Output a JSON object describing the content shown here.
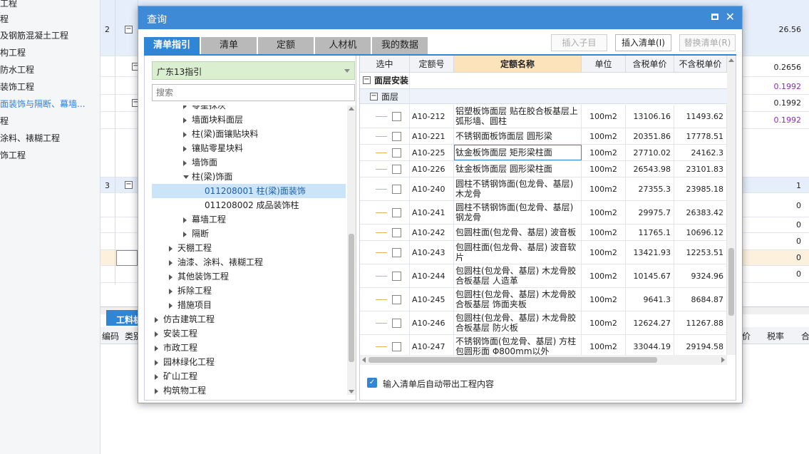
{
  "background": {
    "left_items": [
      {
        "label": "工程",
        "selected": false
      },
      {
        "label": "程",
        "selected": false
      },
      {
        "label": "及钢筋混凝土工程",
        "selected": false
      },
      {
        "label": "构工程",
        "selected": false
      },
      {
        "label": "防水工程",
        "selected": false
      },
      {
        "label": "装饰工程",
        "selected": false
      },
      {
        "label": "面装饰与隔断、幕墙...",
        "selected": true
      },
      {
        "label": "程",
        "selected": false
      },
      {
        "label": "涂料、裱糊工程",
        "selected": false
      },
      {
        "label": "饰工程",
        "selected": false
      }
    ],
    "row_index_2": "2",
    "row_index_3": "3",
    "values": [
      "26.56",
      "0.2656",
      "0.1992",
      "0.1992",
      "0.1992",
      "1",
      "0",
      "0",
      "0",
      "0",
      "0"
    ],
    "bottom_tab": "工料机",
    "bottom_headers": {
      "code": "编码",
      "type": "类别",
      "price": "价",
      "tax": "税率",
      "total": "合"
    }
  },
  "dialog": {
    "title": "查询",
    "tabs": [
      "清单指引",
      "清单",
      "定额",
      "人材机",
      "我的数据"
    ],
    "buttons": {
      "insert_child": "插入子目",
      "insert_list": "插入清单(I)",
      "replace_list": "替换清单(R)"
    },
    "dropdown_value": "广东13指引",
    "search_placeholder": "搜索",
    "tree": [
      {
        "label": "零星抹灰",
        "level": 2,
        "arrow": "right"
      },
      {
        "label": "墙面块料面层",
        "level": 2,
        "arrow": "right"
      },
      {
        "label": "柱(梁)面镶贴块料",
        "level": 2,
        "arrow": "right"
      },
      {
        "label": "镶贴零星块料",
        "level": 2,
        "arrow": "right"
      },
      {
        "label": "墙饰面",
        "level": 2,
        "arrow": "right"
      },
      {
        "label": "柱(梁)饰面",
        "level": 2,
        "arrow": "down"
      },
      {
        "label": "011208001  柱(梁)面装饰",
        "level": 3,
        "arrow": "",
        "selected": true
      },
      {
        "label": "011208002  成品装饰柱",
        "level": 3,
        "arrow": ""
      },
      {
        "label": "幕墙工程",
        "level": 2,
        "arrow": "right"
      },
      {
        "label": "隔断",
        "level": 2,
        "arrow": "right"
      },
      {
        "label": "天棚工程",
        "level": 1,
        "arrow": "right"
      },
      {
        "label": "油漆、涂料、裱糊工程",
        "level": 1,
        "arrow": "right"
      },
      {
        "label": "其他装饰工程",
        "level": 1,
        "arrow": "right"
      },
      {
        "label": "拆除工程",
        "level": 1,
        "arrow": "right"
      },
      {
        "label": "措施项目",
        "level": 1,
        "arrow": "right"
      },
      {
        "label": "仿古建筑工程",
        "level": 0,
        "arrow": "right"
      },
      {
        "label": "安装工程",
        "level": 0,
        "arrow": "right"
      },
      {
        "label": "市政工程",
        "level": 0,
        "arrow": "right"
      },
      {
        "label": "园林绿化工程",
        "level": 0,
        "arrow": "right"
      },
      {
        "label": "矿山工程",
        "level": 0,
        "arrow": "right"
      },
      {
        "label": "构筑物工程",
        "level": 0,
        "arrow": "right"
      }
    ],
    "grid": {
      "headers": [
        "选中",
        "定额号",
        "定额名称",
        "单位",
        "含税单价",
        "不含税单价"
      ],
      "group1": "面层安装",
      "group2": "面层",
      "rows": [
        {
          "code": "A10-212",
          "name": "铝塑板饰面层 贴在胶合板基层上 弧形墙、圆柱",
          "unit": "100m2",
          "tax": "13106.16",
          "notax": "11493.62"
        },
        {
          "code": "A10-221",
          "name": "不锈钢面板饰面层 圆形梁",
          "unit": "100m2",
          "tax": "20351.86",
          "notax": "17778.51"
        },
        {
          "code": "A10-225",
          "name": "钛金板饰面层 矩形梁柱面",
          "unit": "100m2",
          "tax": "27710.02",
          "notax": "24162.3",
          "focus": true
        },
        {
          "code": "A10-226",
          "name": "钛金板饰面层 圆形梁柱面",
          "unit": "100m2",
          "tax": "26543.98",
          "notax": "23101.83"
        },
        {
          "code": "A10-240",
          "name": "圆柱不锈钢饰面(包龙骨、基层) 木龙骨",
          "unit": "100m2",
          "tax": "27355.3",
          "notax": "23985.18"
        },
        {
          "code": "A10-241",
          "name": "圆柱不锈钢饰面(包龙骨、基层) 钢龙骨",
          "unit": "100m2",
          "tax": "29975.7",
          "notax": "26383.42"
        },
        {
          "code": "A10-242",
          "name": "包圆柱面(包龙骨、基层) 波音板",
          "unit": "100m2",
          "tax": "11765.1",
          "notax": "10696.12"
        },
        {
          "code": "A10-243",
          "name": "包圆柱面(包龙骨、基层) 波音软片",
          "unit": "100m2",
          "tax": "13421.93",
          "notax": "12253.51"
        },
        {
          "code": "A10-244",
          "name": "包圆柱(包龙骨、基层) 木龙骨胶合板基层 人造革",
          "unit": "100m2",
          "tax": "10145.67",
          "notax": "9324.96"
        },
        {
          "code": "A10-245",
          "name": "包圆柱(包龙骨、基层) 木龙骨胶合板基层 饰面夹板",
          "unit": "100m2",
          "tax": "9641.3",
          "notax": "8684.87"
        },
        {
          "code": "A10-246",
          "name": "包圆柱(包龙骨、基层) 木龙骨胶合板基层 防火板",
          "unit": "100m2",
          "tax": "12624.27",
          "notax": "11267.88"
        },
        {
          "code": "A10-247",
          "name": "不锈钢饰面(包龙骨、基层) 方柱包圆形面 Φ800mm以外",
          "unit": "100m2",
          "tax": "33044.19",
          "notax": "29194.58"
        }
      ]
    },
    "auto_option": "输入清单后自动带出工程内容"
  }
}
